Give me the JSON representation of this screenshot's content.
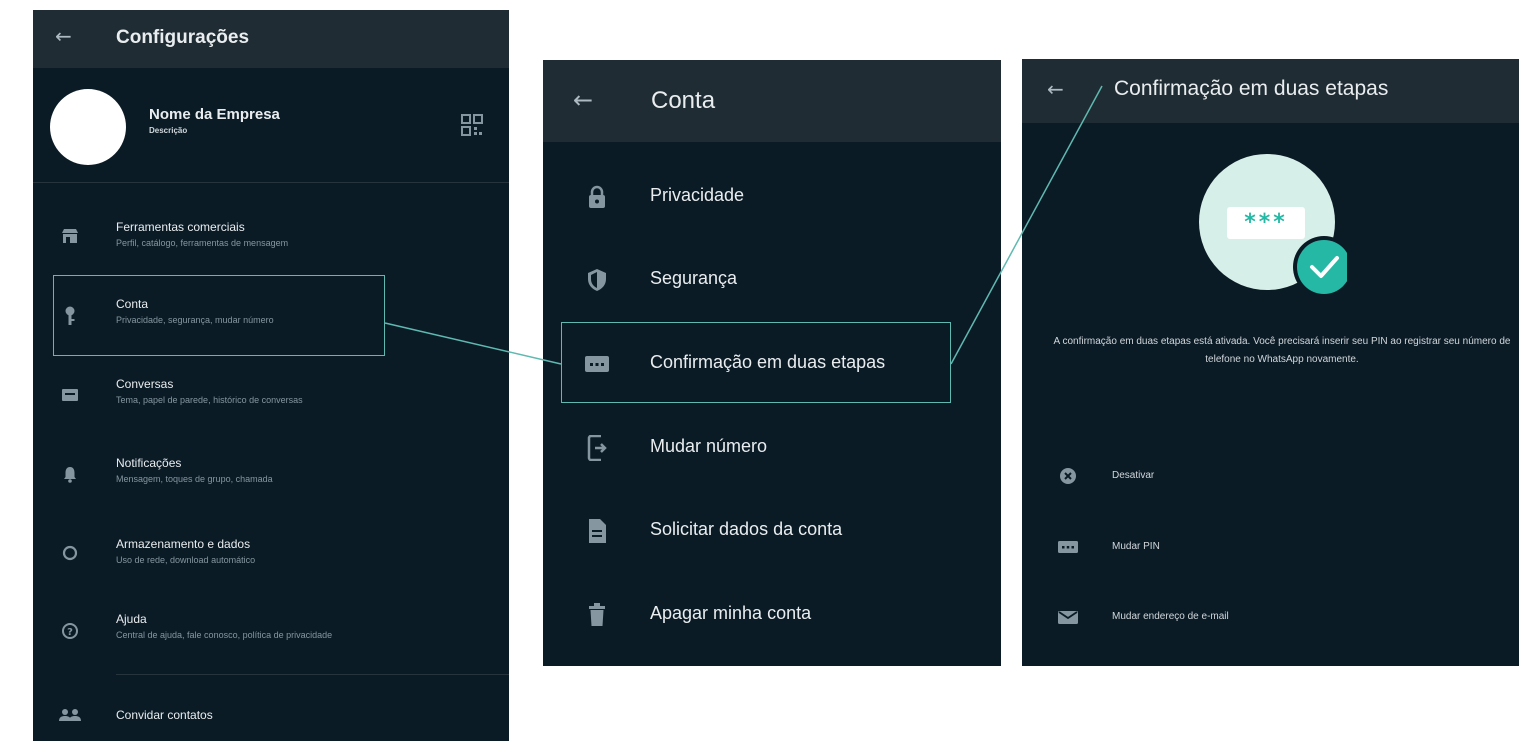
{
  "settings": {
    "title": "Configurações",
    "profile": {
      "name": "Nome da Empresa",
      "description": "Descrição"
    },
    "items": [
      {
        "title": "Ferramentas comerciais",
        "subtitle": "Perfil, catálogo, ferramentas de mensagem",
        "icon": "store-icon"
      },
      {
        "title": "Conta",
        "subtitle": "Privacidade, segurança, mudar número",
        "icon": "key-icon"
      },
      {
        "title": "Conversas",
        "subtitle": "Tema, papel de parede, histórico de conversas",
        "icon": "chat-icon"
      },
      {
        "title": "Notificações",
        "subtitle": "Mensagem, toques de grupo, chamada",
        "icon": "bell-icon"
      },
      {
        "title": "Armazenamento e dados",
        "subtitle": "Uso de rede, download automático",
        "icon": "storage-icon"
      },
      {
        "title": "Ajuda",
        "subtitle": "Central de ajuda, fale conosco, política de privacidade",
        "icon": "help-icon"
      }
    ],
    "invite": {
      "title": "Convidar contatos",
      "icon": "people-icon"
    }
  },
  "account": {
    "title": "Conta",
    "items": [
      {
        "title": "Privacidade",
        "icon": "lock-icon"
      },
      {
        "title": "Segurança",
        "icon": "shield-icon"
      },
      {
        "title": "Confirmação em duas etapas",
        "icon": "pin-dots-icon"
      },
      {
        "title": "Mudar número",
        "icon": "phone-change-icon"
      },
      {
        "title": "Solicitar dados da conta",
        "icon": "document-icon"
      },
      {
        "title": "Apagar minha conta",
        "icon": "trash-icon"
      }
    ]
  },
  "two_step": {
    "title": "Confirmação em duas etapas",
    "pin_mask": "***",
    "description": "A confirmação em duas etapas está ativada. Você precisará inserir seu PIN ao registrar seu número de telefone no WhatsApp novamente.",
    "actions": [
      {
        "title": "Desativar",
        "icon": "close-circle-icon"
      },
      {
        "title": "Mudar PIN",
        "icon": "pin-dots-icon"
      },
      {
        "title": "Mudar endereço de e-mail",
        "icon": "mail-icon"
      }
    ]
  },
  "colors": {
    "panel_bg": "#0b1b26",
    "header_bg": "#1f2c33",
    "accent": "#25b8a5",
    "highlight_border": "#5fb9b0"
  }
}
